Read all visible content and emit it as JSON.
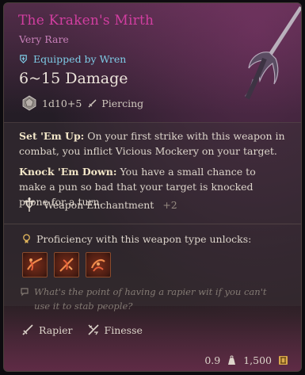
{
  "item": {
    "name": "The Kraken's Mirth",
    "rarity": "Very Rare",
    "equipped_by": "Equipped by Wren",
    "damage": "6~15 Damage",
    "damage_dice": "1d10+5",
    "damage_type": "Piercing"
  },
  "description": {
    "passive1_name": "Set 'Em Up:",
    "passive1_text": " On your first strike with this weapon in combat, you inflict Vicious Mockery on your target.",
    "passive2_name": "Knock 'Em Down:",
    "passive2_text": " You have a small chance to make a pun so bad that your target is knocked prone for a turn."
  },
  "enchantment": {
    "label": "Weapon Enchantment",
    "bonus": "+2"
  },
  "proficiency": {
    "title": "Proficiency with this weapon type unlocks:"
  },
  "flavor_text": "What's the point of having a rapier wit if you can't use it to stab people?",
  "traits": [
    {
      "label": "Rapier"
    },
    {
      "label": "Finesse"
    }
  ],
  "footer": {
    "weight": "0.9",
    "value": "1,500"
  },
  "colors": {
    "title": "#d13ea0",
    "rarity": "#c67fb8",
    "equipped": "#7ecbe6",
    "flavor": "#837a73"
  },
  "icons": {
    "equipped": "equipped-icon",
    "dice": "dice-icon",
    "damage_type": "piercing-icon",
    "enchantment": "enchantment-icon",
    "proficiency": "proficiency-icon",
    "flavor": "speech-icon",
    "rapier": "rapier-icon",
    "finesse": "finesse-icon",
    "weight": "weight-icon",
    "gold": "gold-icon"
  }
}
